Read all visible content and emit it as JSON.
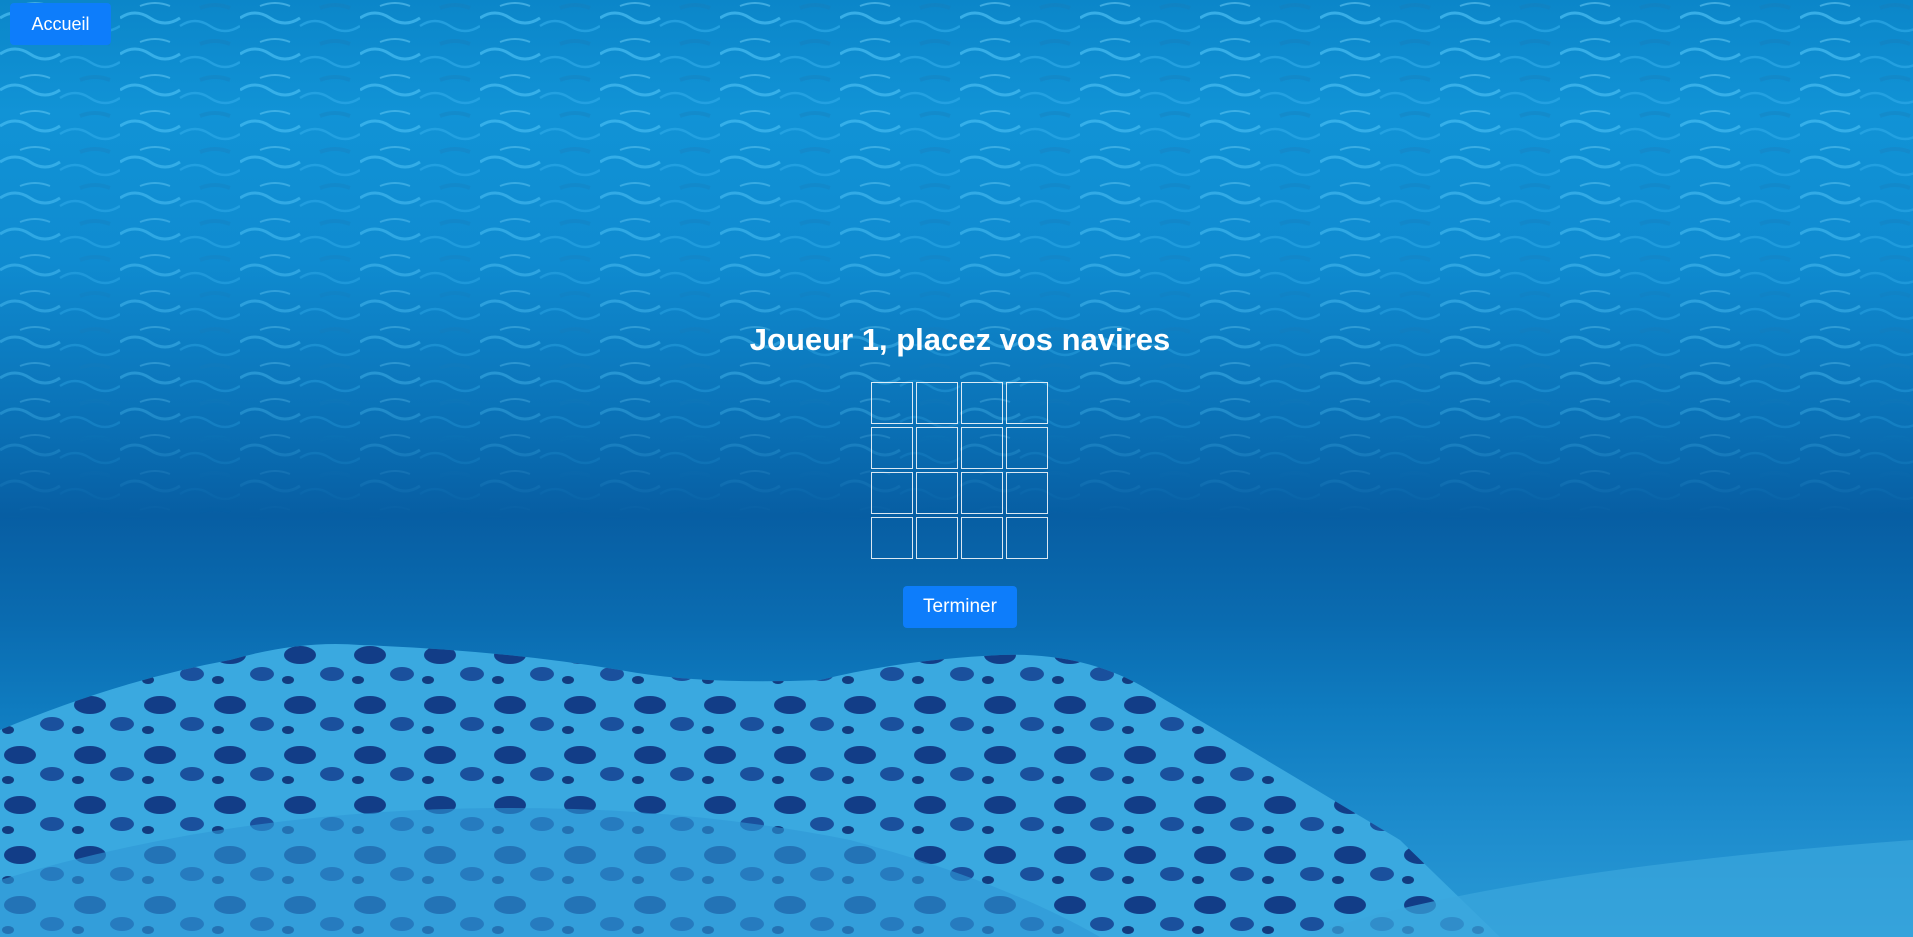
{
  "nav": {
    "home_label": "Accueil"
  },
  "game": {
    "title": "Joueur 1, placez vos navires",
    "grid": {
      "rows": 4,
      "cols": 4
    },
    "finish_label": "Terminer"
  },
  "colors": {
    "button": "#0d7dfb",
    "text": "#ffffff",
    "water": "#0a71b6"
  }
}
